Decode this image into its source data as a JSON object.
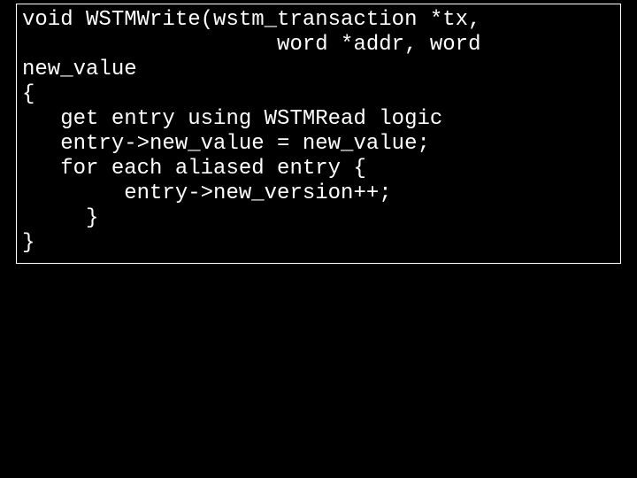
{
  "code": {
    "lines": [
      "void WSTMWrite(wstm_transaction *tx,",
      "                    word *addr, word",
      "new_value",
      "{",
      "   get entry using WSTMRead logic",
      "",
      "   entry->new_value = new_value;",
      "",
      "   for each aliased entry {",
      "        entry->new_version++;",
      "     }",
      "}"
    ]
  }
}
